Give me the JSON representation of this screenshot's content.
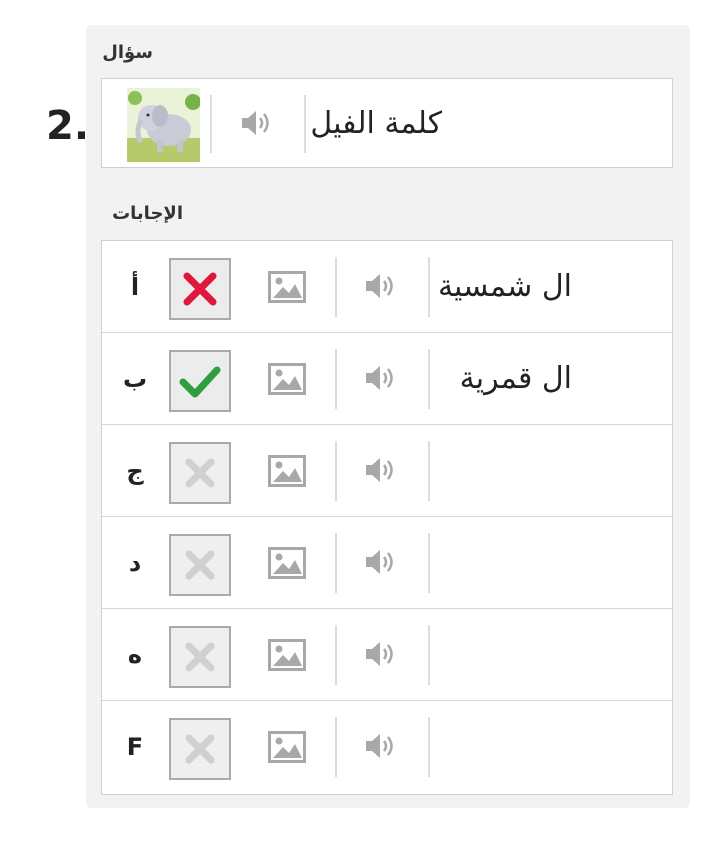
{
  "question_number": "2.",
  "question_section_label": "سؤال",
  "question": {
    "text": "كلمة الفيل",
    "image_alt": "elephant"
  },
  "answers_section_label": "الإجابات",
  "answers": [
    {
      "letter": "أ",
      "text": "ال شمسية",
      "state": "wrong"
    },
    {
      "letter": "ب",
      "text": "ال قمرية",
      "state": "correct"
    },
    {
      "letter": "ج",
      "text": "",
      "state": "empty"
    },
    {
      "letter": "د",
      "text": "",
      "state": "empty"
    },
    {
      "letter": "ه",
      "text": "",
      "state": "empty"
    },
    {
      "letter": "F",
      "text": "",
      "state": "empty"
    }
  ],
  "colors": {
    "wrong": "#e0173c",
    "correct": "#2e9e3e",
    "inactive": "#d0d0d0",
    "icon": "#a8a8a8"
  }
}
